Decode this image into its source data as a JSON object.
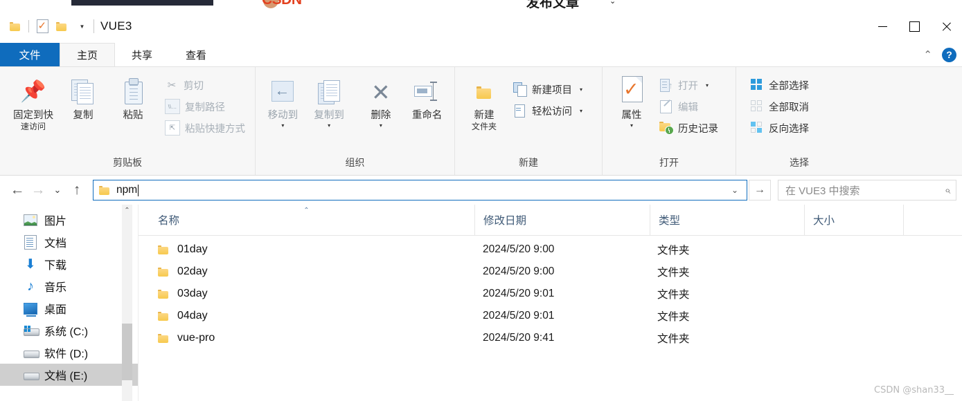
{
  "browser_strip": {
    "csdn_logo": "CSDN",
    "tab_title": "发布文章",
    "chevron": "⌄"
  },
  "titlebar": {
    "quick_access": [
      {
        "name": "folder-icon",
        "label": ""
      },
      {
        "name": "properties-icon",
        "label": ""
      },
      {
        "name": "new-folder-icon",
        "label": ""
      },
      {
        "name": "customize-dropdown",
        "label": "▾"
      }
    ],
    "title": "VUE3",
    "controls": {
      "minimize": "—",
      "maximize": "□",
      "close": "✕"
    }
  },
  "ribbon_tabs": {
    "file": "文件",
    "items": [
      "主页",
      "共享",
      "查看"
    ],
    "active": "主页",
    "collapse": "⌃",
    "help": "?"
  },
  "ribbon": {
    "groups": [
      {
        "label": "剪贴板",
        "big": [
          {
            "label_line1": "固定到快",
            "label_line2": "速访问",
            "icon": "pin-icon"
          },
          {
            "label_line1": "复制",
            "label_line2": "",
            "icon": "copy-icon"
          },
          {
            "label_line1": "粘贴",
            "label_line2": "",
            "icon": "paste-icon"
          }
        ],
        "small": [
          {
            "label": "剪切",
            "icon": "scissors-icon",
            "disabled": true
          },
          {
            "label": "复制路径",
            "icon": "copy-path-icon",
            "disabled": true
          },
          {
            "label": "粘贴快捷方式",
            "icon": "paste-shortcut-icon",
            "disabled": true
          }
        ]
      },
      {
        "label": "组织",
        "big": [
          {
            "label_line1": "移动到",
            "label_line2": "",
            "icon": "move-to-icon",
            "caret": "▾",
            "disabled": true
          },
          {
            "label_line1": "复制到",
            "label_line2": "",
            "icon": "copy-to-icon",
            "caret": "▾",
            "disabled": true
          },
          {
            "label_line1": "删除",
            "label_line2": "",
            "icon": "delete-icon",
            "caret": "▾"
          },
          {
            "label_line1": "重命名",
            "label_line2": "",
            "icon": "rename-icon"
          }
        ],
        "small": []
      },
      {
        "label": "新建",
        "big": [
          {
            "label_line1": "新建",
            "label_line2": "文件夹",
            "icon": "new-folder-icon"
          }
        ],
        "small": [
          {
            "label": "新建项目",
            "icon": "new-item-icon",
            "caret": "▾"
          },
          {
            "label": "轻松访问",
            "icon": "easy-access-icon",
            "caret": "▾"
          }
        ]
      },
      {
        "label": "打开",
        "big": [
          {
            "label_line1": "属性",
            "label_line2": "",
            "icon": "properties-icon",
            "caret": "▾"
          }
        ],
        "small": [
          {
            "label": "打开",
            "icon": "open-icon",
            "caret": "▾",
            "disabled": true
          },
          {
            "label": "编辑",
            "icon": "edit-icon",
            "disabled": true
          },
          {
            "label": "历史记录",
            "icon": "history-icon"
          }
        ]
      },
      {
        "label": "选择",
        "big": [],
        "small": [
          {
            "label": "全部选择",
            "icon": "select-all-icon"
          },
          {
            "label": "全部取消",
            "icon": "select-none-icon"
          },
          {
            "label": "反向选择",
            "icon": "invert-selection-icon"
          }
        ]
      }
    ]
  },
  "addressbar": {
    "back": "←",
    "forward": "→",
    "recent": "⌄",
    "up": "↑",
    "value": "npm",
    "dropdown": "⌄",
    "go": "→",
    "search_placeholder": "在 VUE3 中搜索",
    "search_icon": "⌕"
  },
  "sidebar": {
    "items": [
      {
        "label": "图片",
        "icon": "pictures-icon",
        "selected": false
      },
      {
        "label": "文档",
        "icon": "documents-icon",
        "selected": false
      },
      {
        "label": "下载",
        "icon": "downloads-icon",
        "selected": false
      },
      {
        "label": "音乐",
        "icon": "music-icon",
        "selected": false
      },
      {
        "label": "桌面",
        "icon": "desktop-icon",
        "selected": false
      },
      {
        "label": "系统 (C:)",
        "icon": "system-drive-icon",
        "selected": false
      },
      {
        "label": "软件 (D:)",
        "icon": "drive-icon",
        "selected": false
      },
      {
        "label": "文档 (E:)",
        "icon": "drive-icon",
        "selected": true
      }
    ],
    "scroll_up": "⌃"
  },
  "filelist": {
    "columns": [
      "名称",
      "修改日期",
      "类型",
      "大小"
    ],
    "sort_caret": "⌃",
    "rows": [
      {
        "name": "01day",
        "date": "2024/5/20 9:00",
        "type": "文件夹",
        "size": ""
      },
      {
        "name": "02day",
        "date": "2024/5/20 9:00",
        "type": "文件夹",
        "size": ""
      },
      {
        "name": "03day",
        "date": "2024/5/20 9:01",
        "type": "文件夹",
        "size": ""
      },
      {
        "name": "04day",
        "date": "2024/5/20 9:01",
        "type": "文件夹",
        "size": ""
      },
      {
        "name": "vue-pro",
        "date": "2024/5/20 9:41",
        "type": "文件夹",
        "size": ""
      }
    ]
  },
  "watermark": "CSDN @shan33__",
  "colors": {
    "accent": "#0f6cbd",
    "folder": "#f7c94e",
    "selection": "#cfcfcf"
  }
}
